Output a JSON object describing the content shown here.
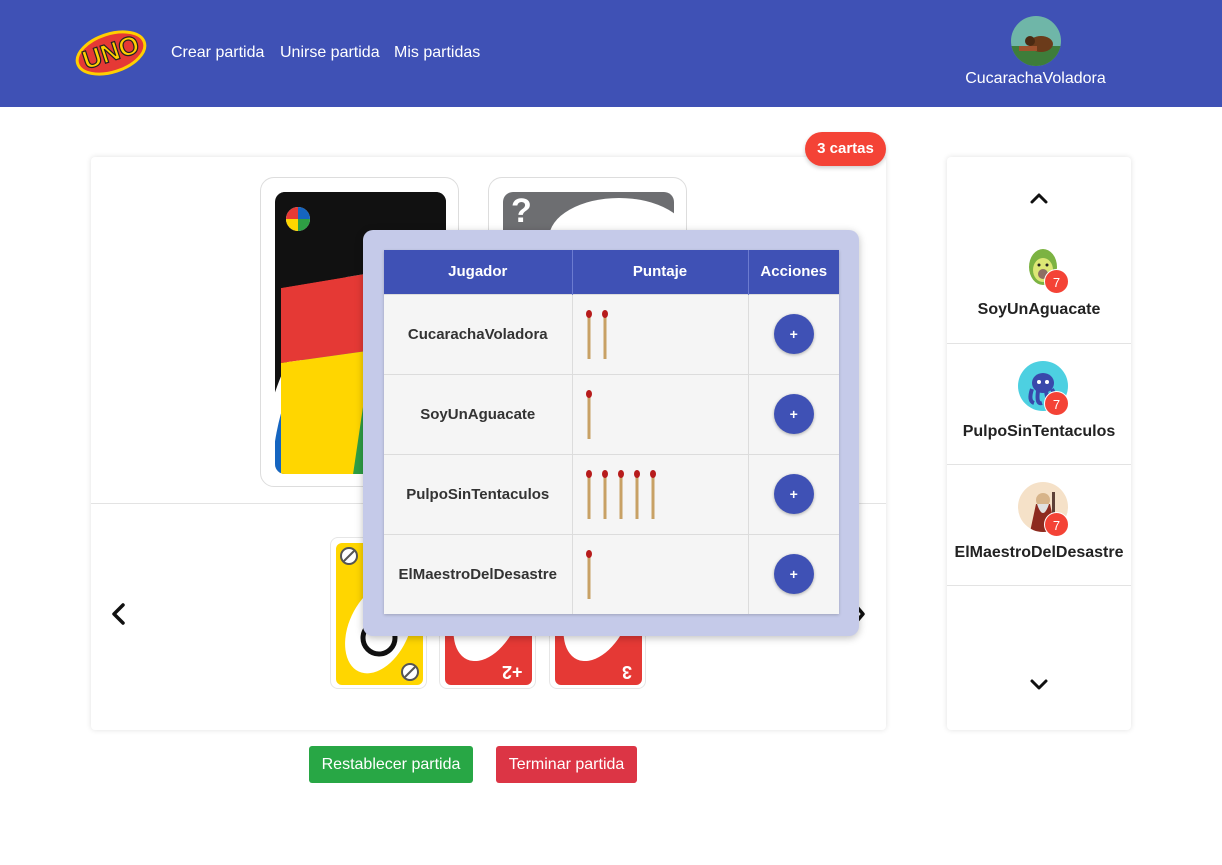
{
  "nav": {
    "links": [
      "Crear partida",
      "Unirse partida",
      "Mis partidas"
    ],
    "user_name": "CucarachaVoladora",
    "logo_text": "UNO"
  },
  "game": {
    "cards_badge": "3 cartas",
    "deck_symbol": "?",
    "hand_cards": [
      {
        "color": "yellow",
        "value": "skip-icon"
      },
      {
        "color": "red",
        "value": "+2"
      },
      {
        "color": "red",
        "value": "3"
      }
    ]
  },
  "score_table": {
    "headers": [
      "Jugador",
      "Puntaje",
      "Acciones"
    ],
    "rows": [
      {
        "player": "CucarachaVoladora",
        "matches": 2,
        "action": "+"
      },
      {
        "player": "SoyUnAguacate",
        "matches": 1,
        "action": "+"
      },
      {
        "player": "PulpoSinTentaculos",
        "matches": 5,
        "action": "+"
      },
      {
        "player": "ElMaestroDelDesastre",
        "matches": 1,
        "action": "+"
      }
    ]
  },
  "players": [
    {
      "name": "SoyUnAguacate",
      "cards": "7",
      "avatar": "avocado-avatar-icon"
    },
    {
      "name": "PulpoSinTentaculos",
      "cards": "7",
      "avatar": "octopus-avatar-icon"
    },
    {
      "name": "ElMaestroDelDesastre",
      "cards": "7",
      "avatar": "wizard-avatar-icon"
    }
  ],
  "buttons": {
    "reset": "Restablecer partida",
    "end": "Terminar partida"
  },
  "colors": {
    "primary": "#3f51b5",
    "danger": "#f44336",
    "success": "#28a745",
    "overlay": "#c5cae9"
  }
}
